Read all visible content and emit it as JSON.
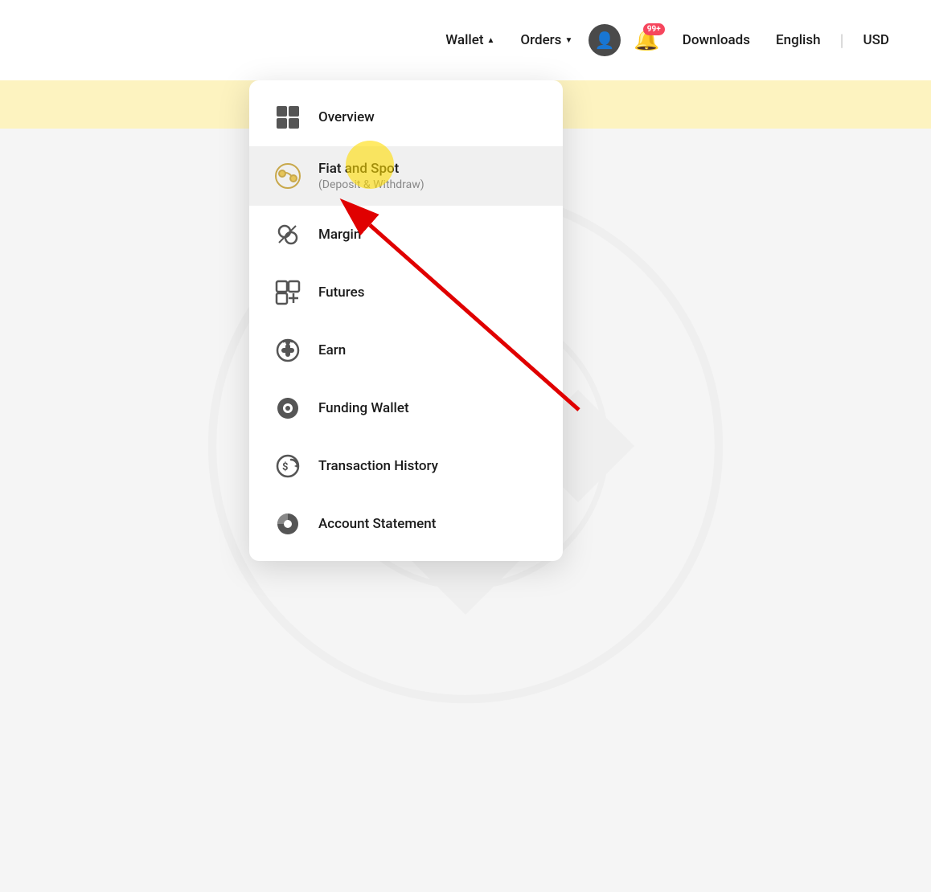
{
  "header": {
    "wallet_label": "Wallet",
    "orders_label": "Orders",
    "downloads_label": "Downloads",
    "english_label": "English",
    "usd_label": "USD",
    "notification_badge": "99+"
  },
  "menu": {
    "items": [
      {
        "id": "overview",
        "label": "Overview",
        "sublabel": "",
        "icon": "grid"
      },
      {
        "id": "fiat-and-spot",
        "label": "Fiat and Spot",
        "sublabel": "(Deposit & Withdraw)",
        "icon": "fiat"
      },
      {
        "id": "margin",
        "label": "Margin",
        "sublabel": "",
        "icon": "margin"
      },
      {
        "id": "futures",
        "label": "Futures",
        "sublabel": "",
        "icon": "futures"
      },
      {
        "id": "earn",
        "label": "Earn",
        "sublabel": "",
        "icon": "earn"
      },
      {
        "id": "funding-wallet",
        "label": "Funding Wallet",
        "sublabel": "",
        "icon": "funding"
      },
      {
        "id": "transaction-history",
        "label": "Transaction History",
        "sublabel": "",
        "icon": "transaction"
      },
      {
        "id": "account-statement",
        "label": "Account Statement",
        "sublabel": "",
        "icon": "account"
      }
    ]
  }
}
